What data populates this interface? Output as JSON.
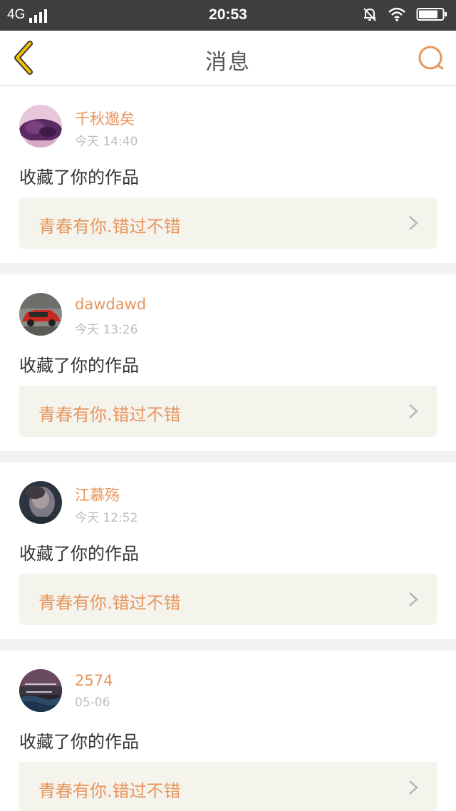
{
  "status_bar": {
    "network": "4G",
    "time": "20:53",
    "icons": [
      "signal-icon",
      "mute-bell-icon",
      "wifi-icon",
      "battery-icon"
    ]
  },
  "header": {
    "title": "消息",
    "back_icon": "chevron-left-icon",
    "search_icon": "search-icon"
  },
  "colors": {
    "accent": "#e8955c",
    "back_icon": "#f2c200",
    "background": "#f2f2f2",
    "card": "#ffffff",
    "link_bg": "#f4f3ec"
  },
  "messages": [
    {
      "username": "千秋邈矣",
      "time": "今天 14:40",
      "action": "收藏了你的作品",
      "work_title": "青春有你.错过不错"
    },
    {
      "username": "dawdawd",
      "time": "今天 13:26",
      "action": "收藏了你的作品",
      "work_title": "青春有你.错过不错"
    },
    {
      "username": "江慕殇",
      "time": "今天 12:52",
      "action": "收藏了你的作品",
      "work_title": "青春有你.错过不错"
    },
    {
      "username": "2574",
      "time": "05-06",
      "action": "收藏了你的作品",
      "work_title": "青春有你.错过不错"
    }
  ]
}
